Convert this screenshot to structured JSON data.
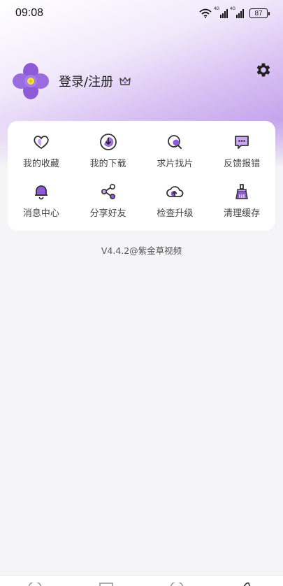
{
  "status_bar": {
    "time": "09:08",
    "network_label_1": "4G",
    "network_label_2": "4G",
    "battery": "87"
  },
  "profile": {
    "login_label": "登录/注册",
    "avatar_icon": "purple-flower-icon",
    "vip_icon": "crown-icon"
  },
  "settings_icon": "gear-icon",
  "menu": {
    "items": [
      {
        "label": "我的收藏",
        "icon": "heart-icon"
      },
      {
        "label": "我的下载",
        "icon": "download-icon"
      },
      {
        "label": "求片找片",
        "icon": "search-movie-icon"
      },
      {
        "label": "反馈报错",
        "icon": "feedback-icon"
      },
      {
        "label": "消息中心",
        "icon": "bell-icon"
      },
      {
        "label": "分享好友",
        "icon": "share-icon"
      },
      {
        "label": "检查升级",
        "icon": "cloud-upgrade-icon"
      },
      {
        "label": "清理缓存",
        "icon": "clean-brush-icon"
      }
    ]
  },
  "version": "V4.4.2@紫金草视频",
  "colors": {
    "accent": "#8e5bd6",
    "accent_light": "#c9a7f2",
    "background": "#f5f5f7"
  }
}
